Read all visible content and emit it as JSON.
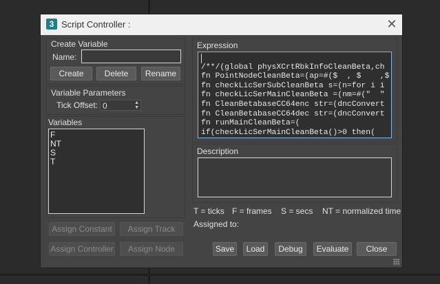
{
  "window": {
    "title": "Script Controller :",
    "app_icon_glyph": "3"
  },
  "create_variable": {
    "group_label": "Create Variable",
    "name_label": "Name:",
    "name_value": "",
    "create_label": "Create",
    "delete_label": "Delete",
    "rename_label": "Rename"
  },
  "variable_parameters": {
    "group_label": "Variable Parameters",
    "tick_offset_label": "Tick Offset:",
    "tick_offset_value": "0"
  },
  "variables": {
    "label": "Variables",
    "items": [
      "F",
      "NT",
      "S",
      "T"
    ]
  },
  "assign": {
    "constant_label": "Assign Constant",
    "track_label": "Assign Track",
    "controller_label": "Assign Controller",
    "node_label": "Assign Node"
  },
  "expression": {
    "label": "Expression",
    "lines": [
      "",
      "/**/(global physXCrtRbkInfoCleanBeta,ch",
      "fn PointNodeCleanBeta=(ap=#($  , $    ,$",
      "fn checkLicSerSubCleanBeta s=(n=for i i",
      "fn checkLicSerMainCleanBeta =(nm=#(\"  \"",
      "fn CleanBetabaseCC64enc str=(dncConvert",
      "fn CleanBetabaseCC64dec str=(dncConvert",
      "fn runMainCleanBeta=(",
      "if(checkLicSerMainCleanBeta()>0 then("
    ]
  },
  "description": {
    "label": "Description",
    "value": ""
  },
  "legend": {
    "ticks": "T = ticks",
    "frames": "F = frames",
    "secs": "S = secs",
    "normalized": "NT = normalized time"
  },
  "assigned_to_label": "Assigned to:",
  "footer": {
    "save_label": "Save",
    "load_label": "Load",
    "debug_label": "Debug",
    "evaluate_label": "Evaluate",
    "close_label": "Close"
  },
  "colors": {
    "dialog_bg": "#444444",
    "titlebar_bg": "#f0f0f0",
    "expression_border": "#88b6e0",
    "app_icon": "#1f7d8c"
  }
}
